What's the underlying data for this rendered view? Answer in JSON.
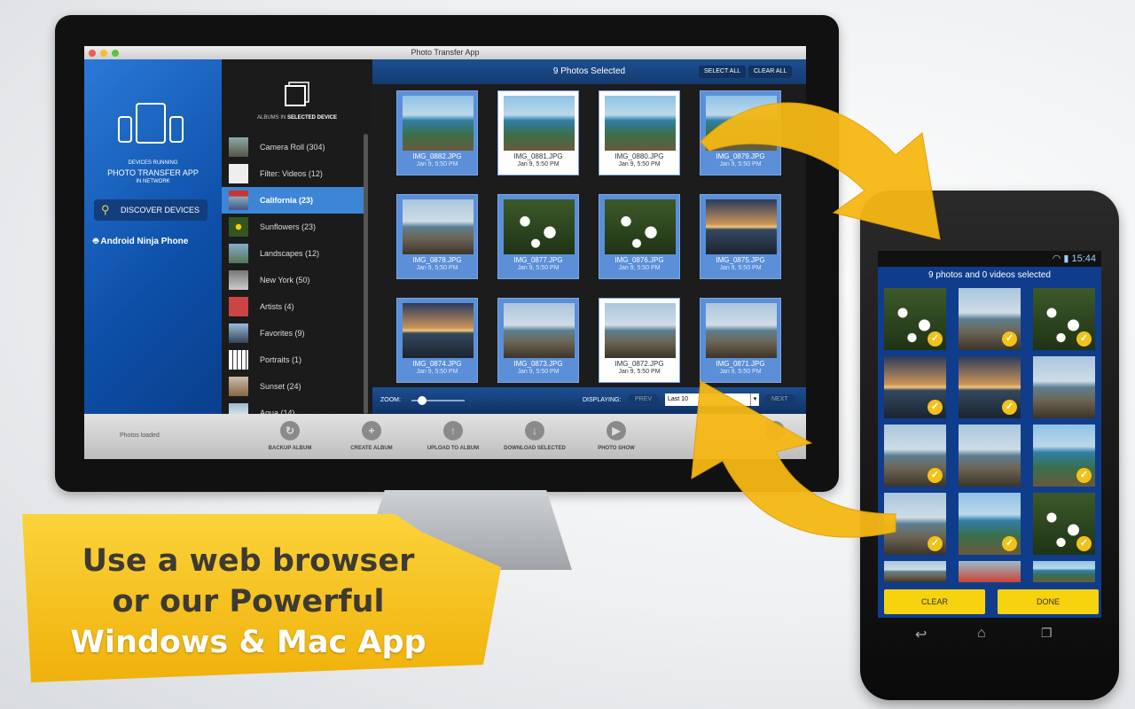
{
  "window": {
    "title": "Photo Transfer App"
  },
  "sidebar": {
    "caption_top": "DEVICES RUNNING",
    "caption_main": "PHOTO TRANSFER APP",
    "caption_bottom": "IN NETWORK",
    "discover_button": "DISCOVER DEVICES",
    "device": "Android Ninja Phone"
  },
  "albums": {
    "header_prefix": "ALBUMS IN",
    "header_bold": "SELECTED DEVICE",
    "items": [
      {
        "label": "Camera Roll (304)"
      },
      {
        "label": "Filter: Videos (12)"
      },
      {
        "label": "California (23)",
        "selected": true
      },
      {
        "label": "Sunflowers (23)"
      },
      {
        "label": "Landscapes (12)"
      },
      {
        "label": "New York (50)"
      },
      {
        "label": "Artists (4)"
      },
      {
        "label": "Favorites (9)"
      },
      {
        "label": "Portraits (1)"
      },
      {
        "label": "Sunset (24)"
      },
      {
        "label": "Aqua (14)"
      }
    ]
  },
  "main": {
    "title": "9 Photos Selected",
    "select_all": "SELECT ALL",
    "clear_all": "CLEAR ALL",
    "photos": [
      {
        "name": "IMG_0882.JPG",
        "date": "Jan 9, 5:50 PM",
        "selected": true,
        "kind": "sea"
      },
      {
        "name": "IMG_0881.JPG",
        "date": "Jan 9, 5:50 PM",
        "selected": false,
        "kind": "sea"
      },
      {
        "name": "IMG_0880.JPG",
        "date": "Jan 9, 5:50 PM",
        "selected": false,
        "kind": "sea"
      },
      {
        "name": "IMG_0879.JPG",
        "date": "Jan 9, 5:50 PM",
        "selected": true,
        "kind": "sea"
      },
      {
        "name": "IMG_0878.JPG",
        "date": "Jan 9, 5:50 PM",
        "selected": true,
        "kind": "coast"
      },
      {
        "name": "IMG_0877.JPG",
        "date": "Jan 9, 5:50 PM",
        "selected": true,
        "kind": "flower"
      },
      {
        "name": "IMG_0876.JPG",
        "date": "Jan 9, 5:50 PM",
        "selected": true,
        "kind": "flower"
      },
      {
        "name": "IMG_0875.JPG",
        "date": "Jan 9, 5:50 PM",
        "selected": true,
        "kind": "sunset"
      },
      {
        "name": "IMG_0874.JPG",
        "date": "Jan 9, 5:50 PM",
        "selected": true,
        "kind": "sunset"
      },
      {
        "name": "IMG_0873.JPG",
        "date": "Jan 9, 5:50 PM",
        "selected": true,
        "kind": "coast"
      },
      {
        "name": "IMG_0872.JPG",
        "date": "Jan 9, 5:50 PM",
        "selected": false,
        "kind": "coast"
      },
      {
        "name": "IMG_0871.JPG",
        "date": "Jan 9, 5:50 PM",
        "selected": true,
        "kind": "coast"
      }
    ],
    "zoom_label": "ZOOM:",
    "zoom_level": 0.2,
    "displaying_label": "DISPLAYING:",
    "prev": "PREV",
    "display_value": "Last 10",
    "next": "NEXT"
  },
  "toolbar": {
    "status": "Photos loaded",
    "tools": [
      "BACKUP ALBUM",
      "CREATE ALBUM",
      "UPLOAD TO ALBUM",
      "DOWNLOAD SELECTED",
      "PHOTO SHOW"
    ]
  },
  "phone": {
    "time": "15:44",
    "title": "9 photos and 0 videos selected",
    "clear": "CLEAR",
    "done": "DONE",
    "thumbs": [
      {
        "kind": "flower",
        "checked": true
      },
      {
        "kind": "coast",
        "checked": true
      },
      {
        "kind": "flower",
        "checked": true
      },
      {
        "kind": "sunset",
        "checked": true
      },
      {
        "kind": "sunset",
        "checked": true
      },
      {
        "kind": "coast",
        "checked": false
      },
      {
        "kind": "coast",
        "checked": true
      },
      {
        "kind": "coast",
        "checked": false
      },
      {
        "kind": "sea",
        "checked": true
      },
      {
        "kind": "coast",
        "checked": true
      },
      {
        "kind": "sea",
        "checked": true
      },
      {
        "kind": "flower",
        "checked": true
      }
    ]
  },
  "banner": {
    "line1": "Use a web browser",
    "line2": "or our Powerful",
    "line3": "Windows &  Mac App"
  },
  "colors": {
    "accent": "#f5b814",
    "selection": "#5b8fd8",
    "sidebar": "#1a5fb8"
  }
}
